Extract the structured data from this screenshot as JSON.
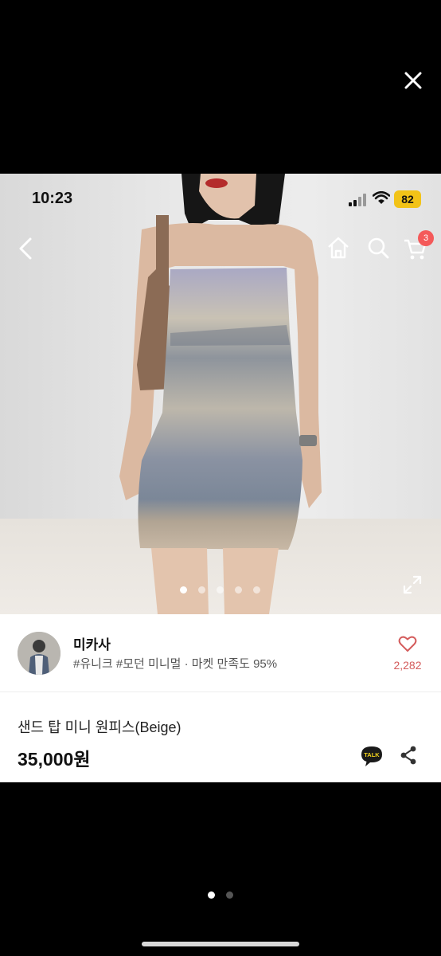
{
  "viewer": {
    "close_icon": "close-icon",
    "page_dots": {
      "count": 2,
      "active": 1
    }
  },
  "status_bar": {
    "time": "10:23",
    "battery": "82",
    "signal_icon": "signal-icon",
    "wifi_icon": "wifi-icon"
  },
  "top_nav": {
    "back_icon": "chevron-left-icon",
    "home_icon": "home-icon",
    "search_icon": "search-icon",
    "cart_icon": "cart-icon",
    "cart_badge": "3"
  },
  "gallery": {
    "image_count": 5,
    "active_index": 1,
    "expand_icon": "expand-icon"
  },
  "seller": {
    "name": "미카사",
    "tags": "#유니크 #모던 미니멀 · 마켓 만족도 95%",
    "like_count": "2,282"
  },
  "product": {
    "title": "샌드 탑 미니 원피스(Beige)",
    "price": "35,000원",
    "talk_label": "TALK"
  },
  "colors": {
    "badge": "#f45a5a",
    "like": "#d45c5c",
    "battery": "#f2c318"
  }
}
